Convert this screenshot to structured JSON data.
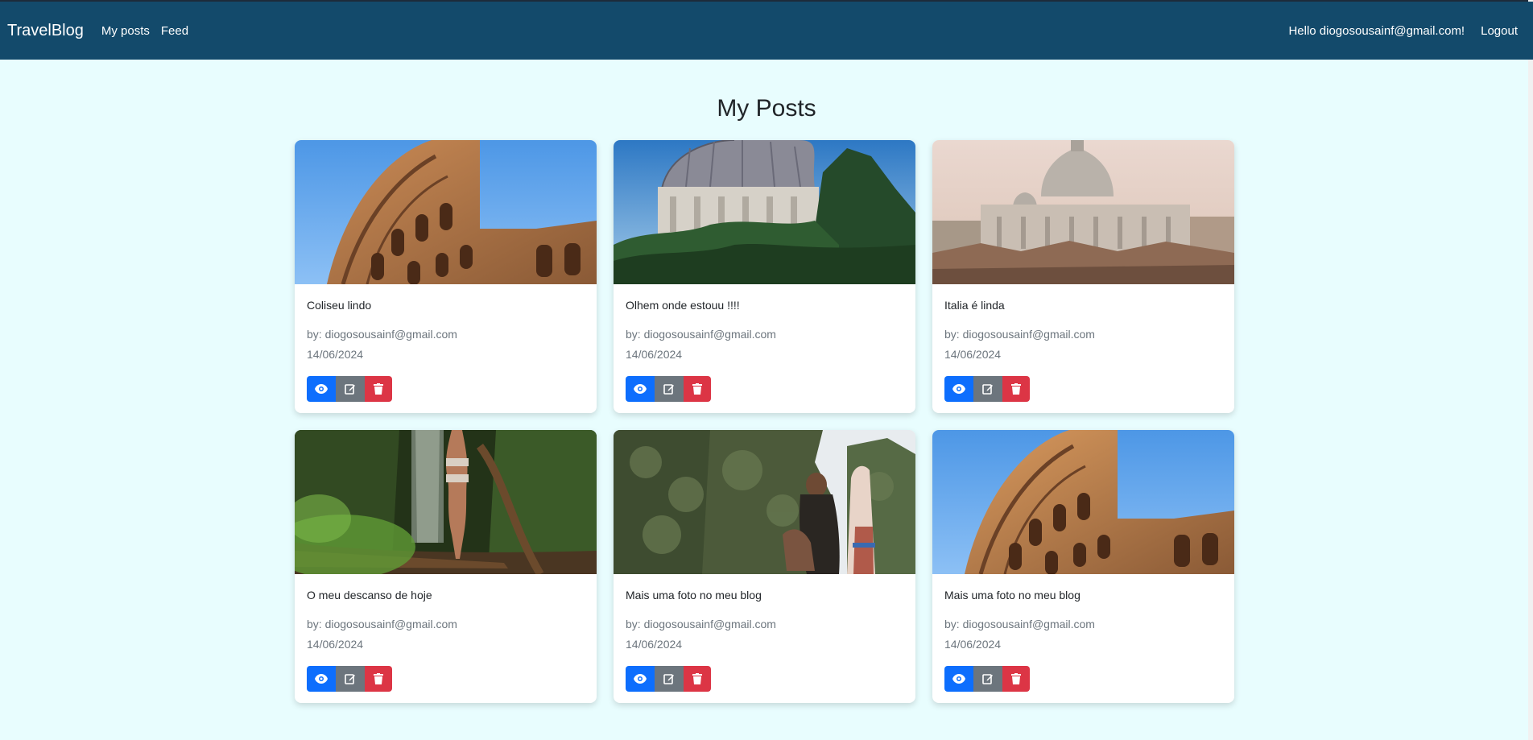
{
  "nav": {
    "brand": "TravelBlog",
    "links": [
      "My posts",
      "Feed"
    ],
    "greeting": "Hello diogosousainf@gmail.com!",
    "logout": "Logout",
    "bg_color": "#134a6b"
  },
  "page": {
    "title": "My Posts",
    "bg_color": "#e8fdfe"
  },
  "posts": [
    {
      "title": "Coliseu lindo",
      "author": "by: diogosousainf@gmail.com",
      "date": "14/06/2024",
      "image": "colosseum-photo"
    },
    {
      "title": "Olhem onde estouu !!!!",
      "author": "by: diogosousainf@gmail.com",
      "date": "14/06/2024",
      "image": "dome-trees-photo"
    },
    {
      "title": "Italia é linda",
      "author": "by: diogosousainf@gmail.com",
      "date": "14/06/2024",
      "image": "vatican-skyline-photo"
    },
    {
      "title": "O meu descanso de hoje",
      "author": "by: diogosousainf@gmail.com",
      "date": "14/06/2024",
      "image": "jungle-waterfall-photo"
    },
    {
      "title": "Mais uma foto no meu blog",
      "author": "by: diogosousainf@gmail.com",
      "date": "14/06/2024",
      "image": "cliffs-boat-photo"
    },
    {
      "title": "Mais uma foto no meu blog",
      "author": "by: diogosousainf@gmail.com",
      "date": "14/06/2024",
      "image": "colosseum-photo"
    }
  ],
  "buttons": {
    "view_icon": "eye-icon",
    "edit_icon": "edit-icon",
    "delete_icon": "trash-icon",
    "view_color": "#0d6efd",
    "edit_color": "#6c757d",
    "delete_color": "#dc3545"
  }
}
